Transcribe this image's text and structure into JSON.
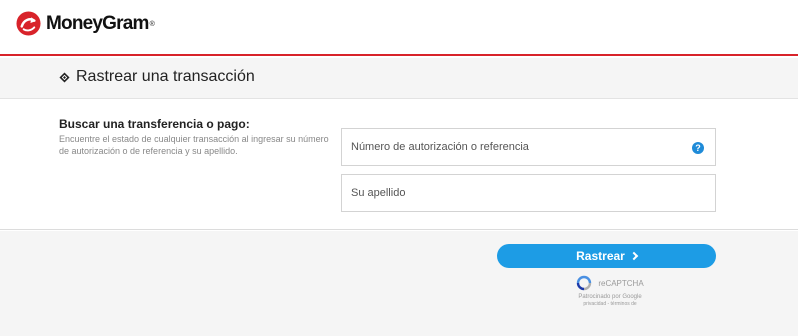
{
  "brand": {
    "name": "MoneyGram",
    "reg_mark": "®",
    "logo_icon": "moneygram-arrow-logo",
    "accent_color": "#d8232a"
  },
  "page": {
    "title": "Rastrear una transacción",
    "title_icon": "diamond-icon"
  },
  "search": {
    "heading": "Buscar una transferencia o pago:",
    "description": "Encuentre el estado de cualquier transacción al ingresar su número de autorización o de referencia y su apellido.",
    "auth_field": {
      "placeholder": "Número de autorización o referencia",
      "value": "",
      "help_icon": "question-circle-icon",
      "help_glyph": "?"
    },
    "name_field": {
      "placeholder": "Su apellido",
      "value": ""
    }
  },
  "actions": {
    "track_label": "Rastrear",
    "track_icon": "chevron-right-icon",
    "button_color": "#1d9ce5"
  },
  "recaptcha": {
    "label": "reCAPTCHA",
    "sponsor": "Patrocinado por Google",
    "links": "privacidad - términos de"
  }
}
